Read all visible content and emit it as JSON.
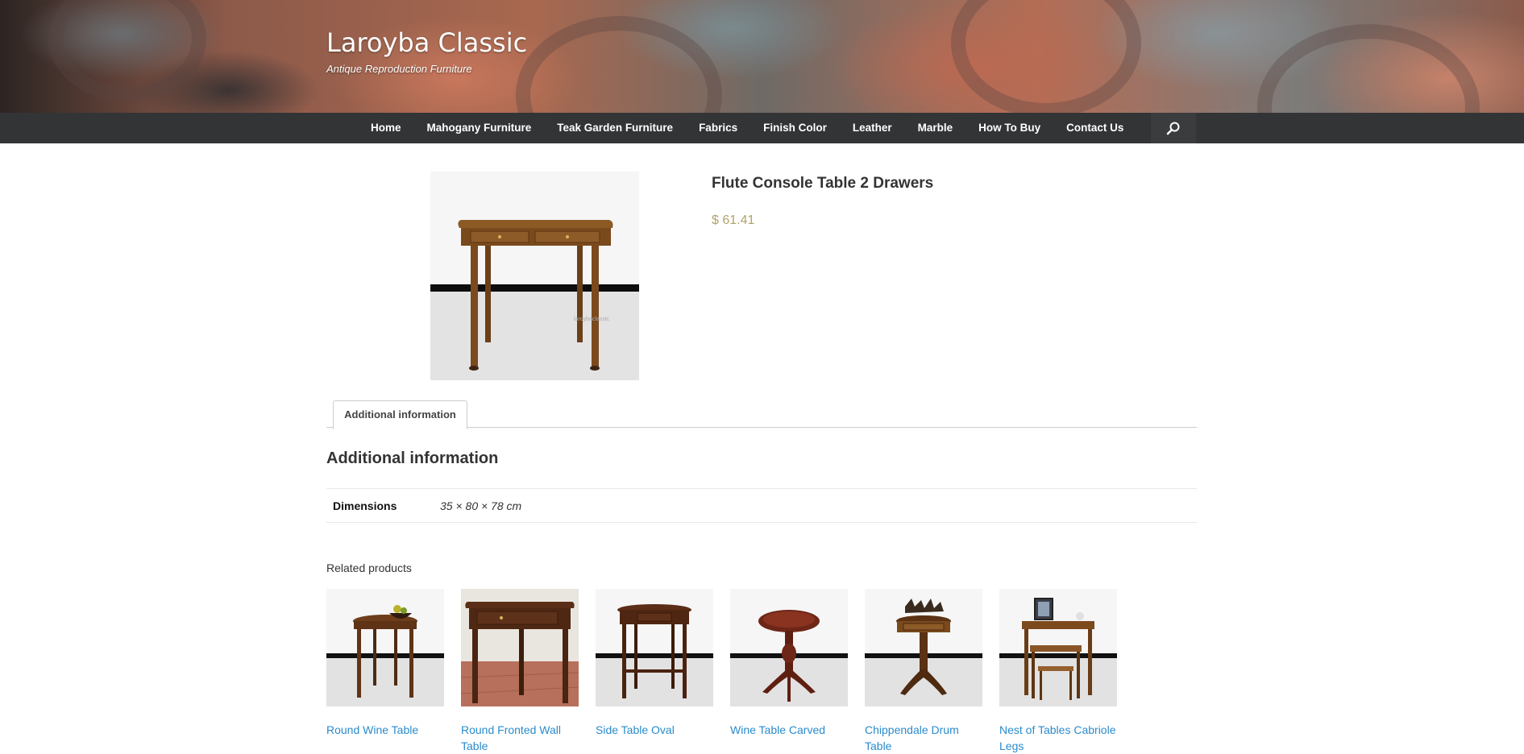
{
  "site": {
    "title": "Laroyba Classic",
    "tagline": "Antique Reproduction Furniture"
  },
  "nav": {
    "items": [
      {
        "label": "Home"
      },
      {
        "label": "Mahogany Furniture"
      },
      {
        "label": "Teak Garden Furniture"
      },
      {
        "label": "Fabrics"
      },
      {
        "label": "Finish Color"
      },
      {
        "label": "Leather"
      },
      {
        "label": "Marble"
      },
      {
        "label": "How To Buy"
      },
      {
        "label": "Contact Us"
      }
    ],
    "search_icon": "search-icon"
  },
  "product": {
    "title": "Flute Console Table 2 Drawers",
    "price": "$ 61.41",
    "watermark": "laroybaclassic"
  },
  "tabs": [
    {
      "label": "Additional information"
    }
  ],
  "additional_info": {
    "heading": "Additional information",
    "rows": [
      {
        "label": "Dimensions",
        "value": "35 × 80 × 78 cm"
      }
    ]
  },
  "related": {
    "heading": "Related products",
    "items": [
      {
        "name": "Round Wine Table"
      },
      {
        "name": "Round Fronted Wall Table"
      },
      {
        "name": "Side Table Oval"
      },
      {
        "name": "Wine Table Carved"
      },
      {
        "name": "Chippendale Drum Table"
      },
      {
        "name": "Nest of Tables Cabriole Legs"
      }
    ]
  },
  "colors": {
    "nav_bg": "#333436",
    "price": "#b2a36a",
    "link": "#2b8bcc"
  }
}
